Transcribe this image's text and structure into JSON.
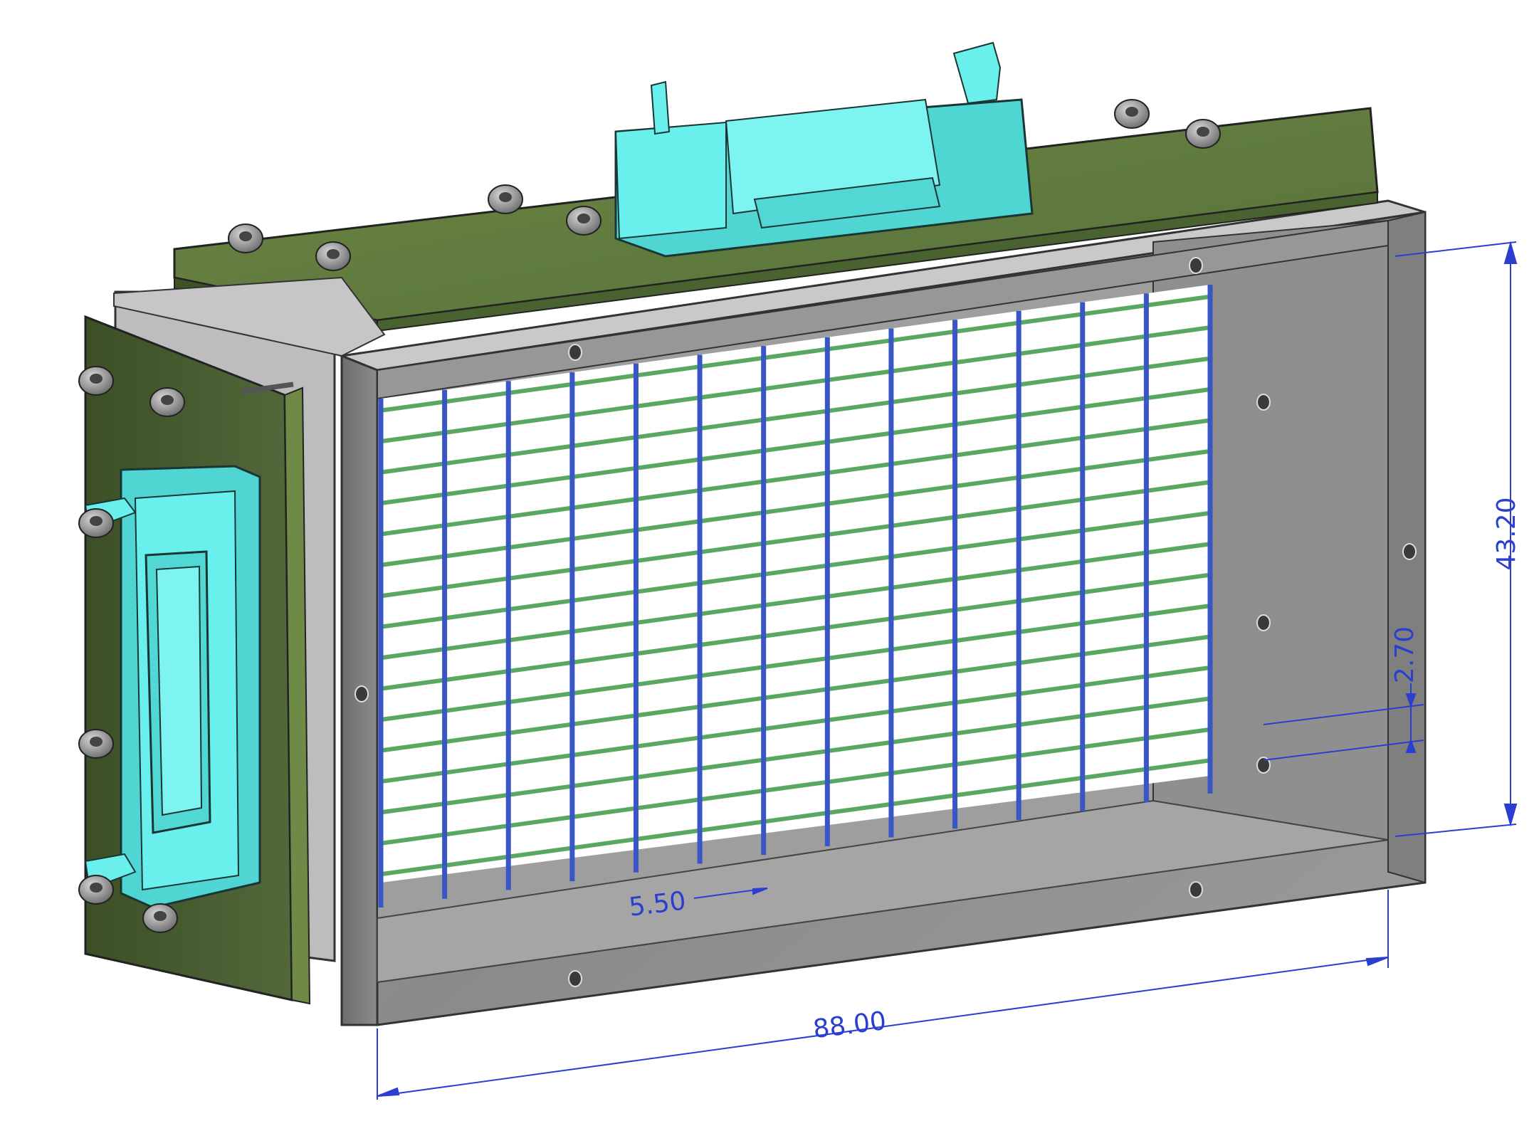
{
  "dimensions": {
    "width_label": "88.00",
    "height_label": "43.20",
    "wire_pitch_label": "5.50",
    "wire_gap_label": "2.70"
  },
  "colors": {
    "frame_grey": "#8e8e8e",
    "frame_edge": "#3a3a3a",
    "pcb_green": "#5f7a3a",
    "pcb_dark": "#3f5228",
    "connector_cyan": "#5fe8e4",
    "wire_blue": "#3a55c4",
    "wire_green": "#5aa860",
    "dimension_blue": "#2a3fd0",
    "screw_grey": "#7a7a7a"
  },
  "grid": {
    "vertical_wire_count": 14,
    "horizontal_wire_count": 16
  }
}
